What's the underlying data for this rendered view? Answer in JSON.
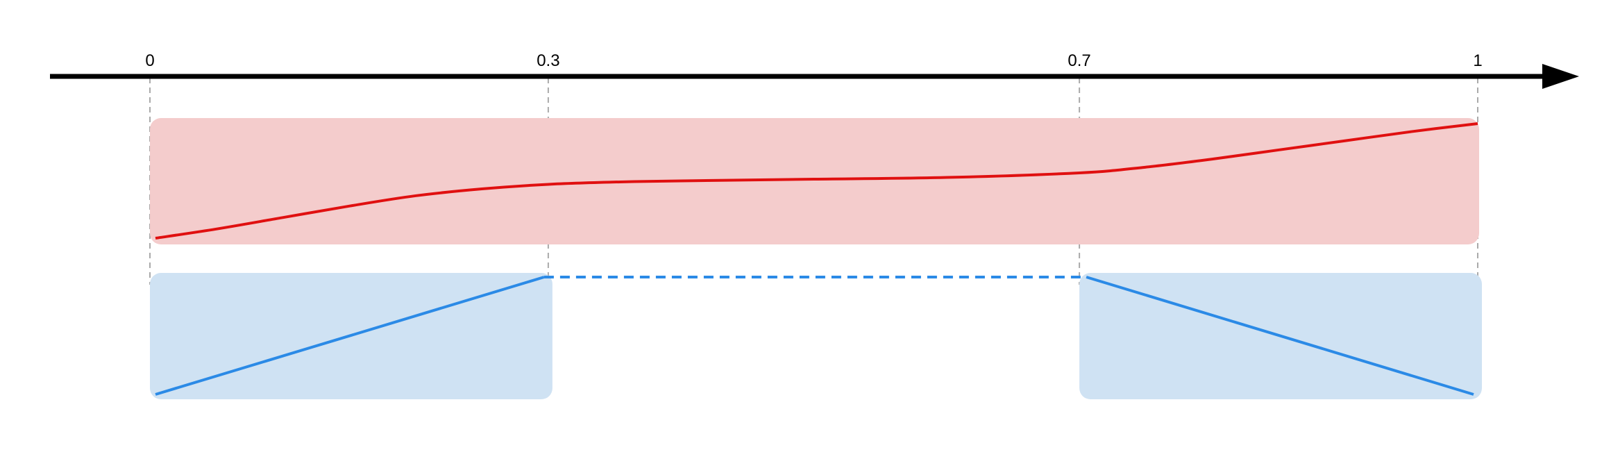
{
  "axis": {
    "ticks": [
      {
        "value": 0,
        "label": "0"
      },
      {
        "value": 0.3,
        "label": "0.3"
      },
      {
        "value": 0.7,
        "label": "0.7"
      },
      {
        "value": 1,
        "label": "1"
      }
    ]
  },
  "easing_curve": {
    "description_free": true,
    "points": [
      [
        0,
        0
      ],
      [
        0.05,
        0.08
      ],
      [
        0.1,
        0.18
      ],
      [
        0.15,
        0.28
      ],
      [
        0.2,
        0.37
      ],
      [
        0.25,
        0.43
      ],
      [
        0.3,
        0.47
      ],
      [
        0.35,
        0.49
      ],
      [
        0.4,
        0.5
      ],
      [
        0.5,
        0.515
      ],
      [
        0.6,
        0.53
      ],
      [
        0.7,
        0.57
      ],
      [
        0.75,
        0.62
      ],
      [
        0.8,
        0.69
      ],
      [
        0.85,
        0.77
      ],
      [
        0.9,
        0.85
      ],
      [
        0.95,
        0.93
      ],
      [
        1,
        1
      ]
    ]
  },
  "fade_segments": [
    {
      "start": 0,
      "end": 0.3,
      "direction": "in"
    },
    {
      "start": 0.7,
      "end": 1,
      "direction": "out"
    }
  ],
  "colors": {
    "axis": "#000000",
    "guide": "#aaaaaa",
    "curve_band_fill": "#f4cccc",
    "curve_stroke": "#e01010",
    "fade_band_fill": "#cfe2f3",
    "fade_stroke": "#2b8ae6"
  }
}
